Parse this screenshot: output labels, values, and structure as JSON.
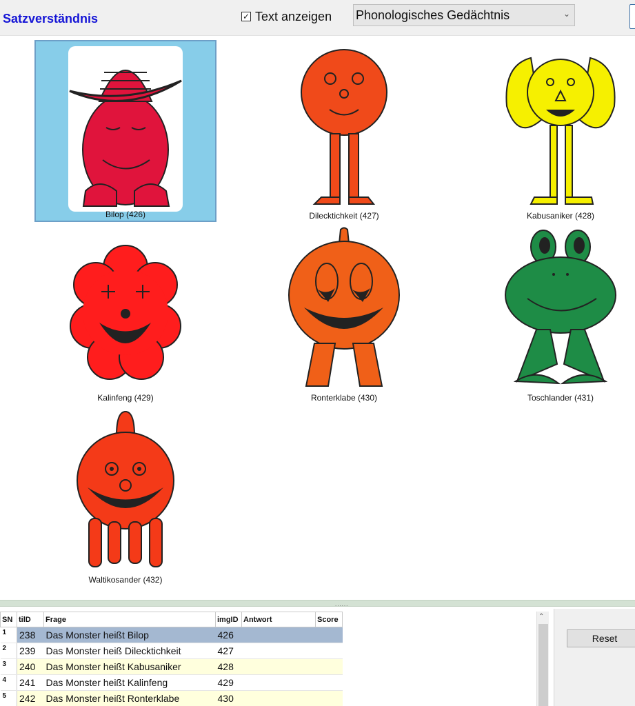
{
  "toolbar": {
    "title": "Satzverständnis",
    "show_text_checked": true,
    "show_text_label": "Text anzeigen",
    "mode_select_value": "Phonologisches Gedächtnis"
  },
  "gallery": {
    "items": [
      {
        "label": "Bilop (426)",
        "color": "#e0143c",
        "selected": true
      },
      {
        "label": "Dilecktichkeit (427)",
        "color": "#f04a1a",
        "selected": false
      },
      {
        "label": "Kabusaniker (428)",
        "color": "#f6f000",
        "selected": false
      },
      {
        "label": "Kalinfeng (429)",
        "color": "#ff1d1d",
        "selected": false
      },
      {
        "label": "Ronterklabe (430)",
        "color": "#f06018",
        "selected": false
      },
      {
        "label": "Toschlander (431)",
        "color": "#1e8c46",
        "selected": false
      },
      {
        "label": "Waltikosander (432)",
        "color": "#f43a18",
        "selected": false
      }
    ]
  },
  "table": {
    "columns": [
      "SN",
      "tilD",
      "Frage",
      "imgID",
      "Antwort",
      "Score"
    ],
    "rows": [
      {
        "sn": "1",
        "tilid": "238",
        "frage": "Das Monster heißt Bilop",
        "imgid": "426",
        "antwort": "",
        "score": ""
      },
      {
        "sn": "2",
        "tilid": "239",
        "frage": "Das Monster heiß Dilecktichkeit",
        "imgid": "427",
        "antwort": "",
        "score": ""
      },
      {
        "sn": "3",
        "tilid": "240",
        "frage": "Das Monster heißt Kabusaniker",
        "imgid": "428",
        "antwort": "",
        "score": ""
      },
      {
        "sn": "4",
        "tilid": "241",
        "frage": "Das Monster heißt Kalinfeng",
        "imgid": "429",
        "antwort": "",
        "score": ""
      },
      {
        "sn": "5",
        "tilid": "242",
        "frage": "Das Monster heißt Ronterklabe",
        "imgid": "430",
        "antwort": "",
        "score": ""
      }
    ],
    "selected_row": 0
  },
  "side_panel": {
    "reset_label": "Reset"
  },
  "colors": {
    "title": "#1515d6",
    "selection_bg": "#87cde9",
    "row_selected": "#a4b8d1",
    "row_alt": "#ffffdd"
  }
}
